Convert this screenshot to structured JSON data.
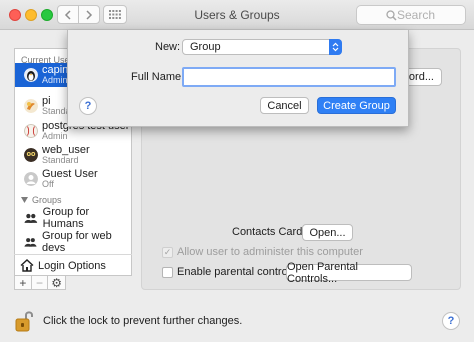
{
  "window": {
    "title": "Users & Groups"
  },
  "search": {
    "placeholder": "Search"
  },
  "sidebar": {
    "current_users_heading": "Current Users",
    "users": [
      {
        "name": "capin",
        "role": "Admin",
        "selected": true
      },
      {
        "name": "pi",
        "role": "Standard"
      },
      {
        "name": "postgres test user",
        "role": "Admin"
      },
      {
        "name": "web_user",
        "role": "Standard"
      },
      {
        "name": "Guest User",
        "role": "Off"
      }
    ],
    "groups_heading": "Groups",
    "groups": [
      {
        "name": "Group for Humans"
      },
      {
        "name": "Group for web devs"
      }
    ],
    "login_options": "Login Options",
    "add": "+",
    "remove": "−",
    "settings": "⚙"
  },
  "panel": {
    "password_button": "ord...",
    "contacts_card_label": "Contacts Card:",
    "open_button": "Open...",
    "allow_admin_label": "Allow user to administer this computer",
    "parental_label": "Enable parental controls",
    "open_parental_button": "Open Parental Controls..."
  },
  "sheet": {
    "new_label": "New:",
    "new_value": "Group",
    "fullname_label": "Full Name:",
    "fullname_value": "",
    "help": "?",
    "cancel": "Cancel",
    "create": "Create Group"
  },
  "footer": {
    "lock_text": "Click the lock to prevent further changes.",
    "help": "?"
  }
}
